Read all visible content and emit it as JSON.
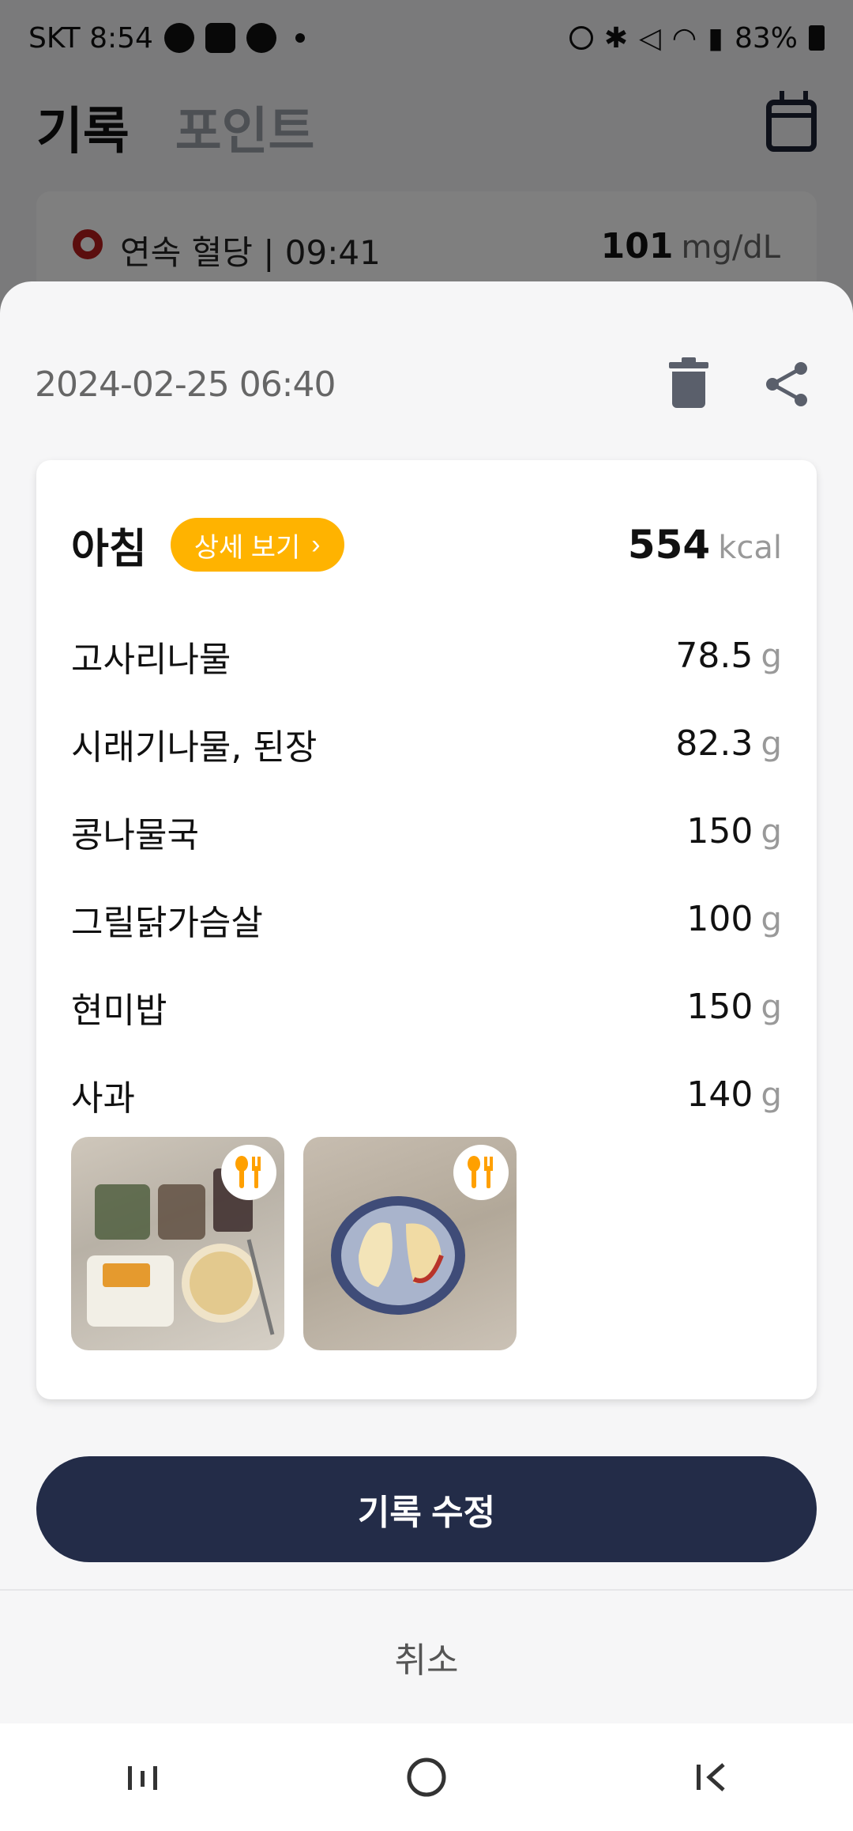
{
  "status_bar": {
    "carrier_time": "SKT 8:54",
    "battery": "83%"
  },
  "app_header": {
    "tabs": [
      {
        "label": "기록",
        "active": true
      },
      {
        "label": "포인트",
        "active": false
      }
    ],
    "calendar_icon": "calendar-icon"
  },
  "glucose": {
    "label": "연속 혈당 | 09:41",
    "value": "101",
    "unit": "mg/dL"
  },
  "sheet": {
    "datetime": "2024-02-25 06:40",
    "delete_icon": "trash-icon",
    "share_icon": "share-icon",
    "meal": {
      "title": "아침",
      "detail_label": "상세 보기",
      "kcal": "554",
      "kcal_unit": "kcal",
      "foods": [
        {
          "name": "고사리나물",
          "amount": "78.5",
          "unit": "g"
        },
        {
          "name": "시래기나물, 된장",
          "amount": "82.3",
          "unit": "g"
        },
        {
          "name": "콩나물국",
          "amount": "150",
          "unit": "g"
        },
        {
          "name": "그릴닭가슴살",
          "amount": "100",
          "unit": "g"
        },
        {
          "name": "현미밥",
          "amount": "150",
          "unit": "g"
        },
        {
          "name": "사과",
          "amount": "140",
          "unit": "g"
        }
      ],
      "photos": [
        "meal-photo-breakfast-tray",
        "meal-photo-apple"
      ]
    },
    "edit_label": "기록 수정",
    "cancel_label": "취소"
  },
  "colors": {
    "accent_yellow": "#ffb300",
    "primary_navy": "#232c48",
    "glucose_red": "#b71c1c"
  }
}
